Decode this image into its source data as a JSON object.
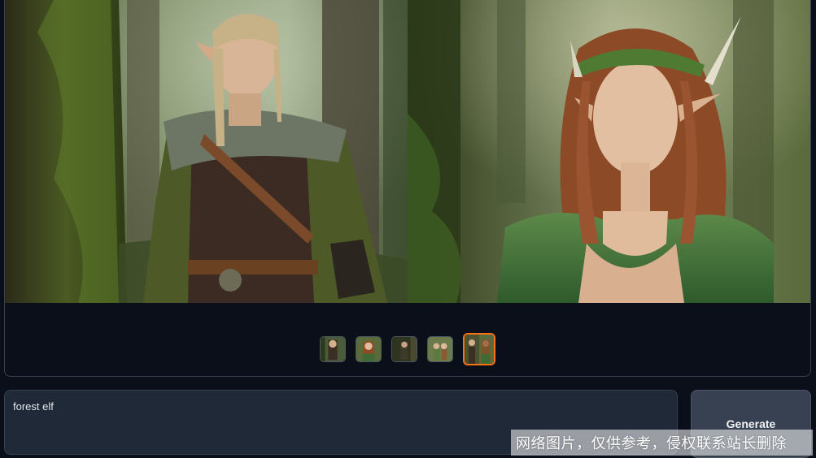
{
  "gallery": {
    "images": [
      {
        "alt": "elf-warrior-portrait",
        "selected": false
      },
      {
        "alt": "elf-woman-portrait",
        "selected": false
      },
      {
        "alt": "elf-warrior-dark-forest",
        "selected": false
      },
      {
        "alt": "elf-pair-forest",
        "selected": false
      },
      {
        "alt": "elf-pair-preview",
        "selected": true
      }
    ]
  },
  "prompt": {
    "value": "forest elf",
    "placeholder": ""
  },
  "generate_button": {
    "label": "Generate"
  },
  "watermark": {
    "text": "网络图片，仅供参考，侵权联系站长删除"
  },
  "colors": {
    "background": "#0b0f19",
    "panel_border": "#374151",
    "input_bg": "#1f2937",
    "button_bg": "#374151",
    "selected_accent": "#f97316"
  }
}
